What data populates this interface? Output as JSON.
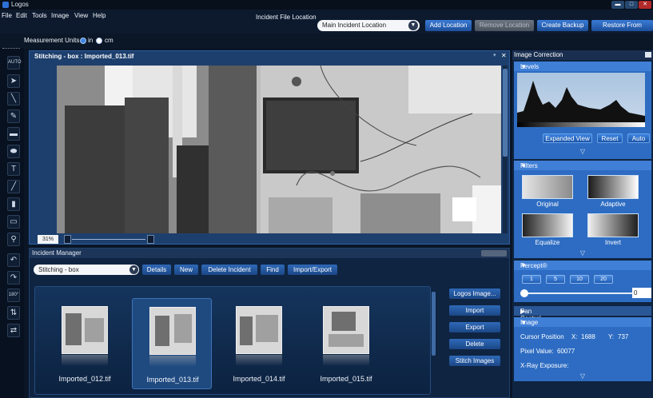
{
  "app": {
    "title": "Logos"
  },
  "window": {
    "minimize": "▬",
    "maximize": "□",
    "close": "✕"
  },
  "menu": [
    "File",
    "Edit",
    "Tools",
    "Image",
    "View",
    "Help"
  ],
  "location": {
    "label": "Incident File Location",
    "selected": "Main Incident Location",
    "buttons": [
      "Add Location",
      "Remove Location",
      "Create Backup",
      "Restore From Backup"
    ]
  },
  "units": {
    "label": "Measurement Units",
    "options": [
      "in",
      "cm"
    ],
    "selected": "cm"
  },
  "toolbar": {
    "auto_label": "AUTO",
    "rotate_label": "180°",
    "tools": [
      "pointer-icon",
      "line-icon",
      "pen-icon",
      "rectangle-fill-icon",
      "ellipse-icon",
      "text-icon",
      "ruler-icon",
      "eraser-icon",
      "selection-icon",
      "zoom-icon",
      "rotate-left-icon",
      "rotate-right-icon",
      "rotate-180-icon",
      "flip-icon",
      "flip-horizontal-icon"
    ]
  },
  "viewer": {
    "title": "Stitching - box : Imported_013.tif",
    "zoom": "31%"
  },
  "incident_manager": {
    "title": "Incident Manager",
    "case_selected": "Stitching - box",
    "buttons": [
      "Details",
      "New",
      "Delete Incident",
      "Find",
      "Import/Export"
    ],
    "thumbnails": [
      {
        "label": "Imported_012.tif",
        "selected": false
      },
      {
        "label": "Imported_013.tif",
        "selected": true
      },
      {
        "label": "Imported_014.tif",
        "selected": false
      },
      {
        "label": "Imported_015.tif",
        "selected": false
      }
    ],
    "side_buttons": [
      "Logos Image...",
      "Import",
      "Export",
      "Delete",
      "Stitch Images"
    ]
  },
  "image_correction": {
    "title": "Image Correction",
    "levels": {
      "title": "Levels",
      "buttons": [
        "Expanded View",
        "Reset",
        "Auto"
      ]
    },
    "filters": {
      "title": "Filters",
      "items": [
        "Original",
        "Adaptive",
        "Equalize",
        "Invert"
      ]
    },
    "contrast": {
      "title": "Percept® Contrast",
      "presets": [
        "1",
        "5",
        "10",
        "20"
      ],
      "value": "0"
    },
    "pan_control": {
      "title": "Pan Control"
    },
    "image_details": {
      "title": "Image Details",
      "cursor_label": "Cursor Position",
      "x_label": "X:",
      "x_value": "1688",
      "y_label": "Y:",
      "y_value": "737",
      "pixel_label": "Pixel Value:",
      "pixel_value": "60077",
      "exposure_label": "X-Ray Exposure:"
    }
  },
  "chevrons": {
    "down": "▽",
    "collapsed": "▶",
    "expanded": "▼"
  }
}
